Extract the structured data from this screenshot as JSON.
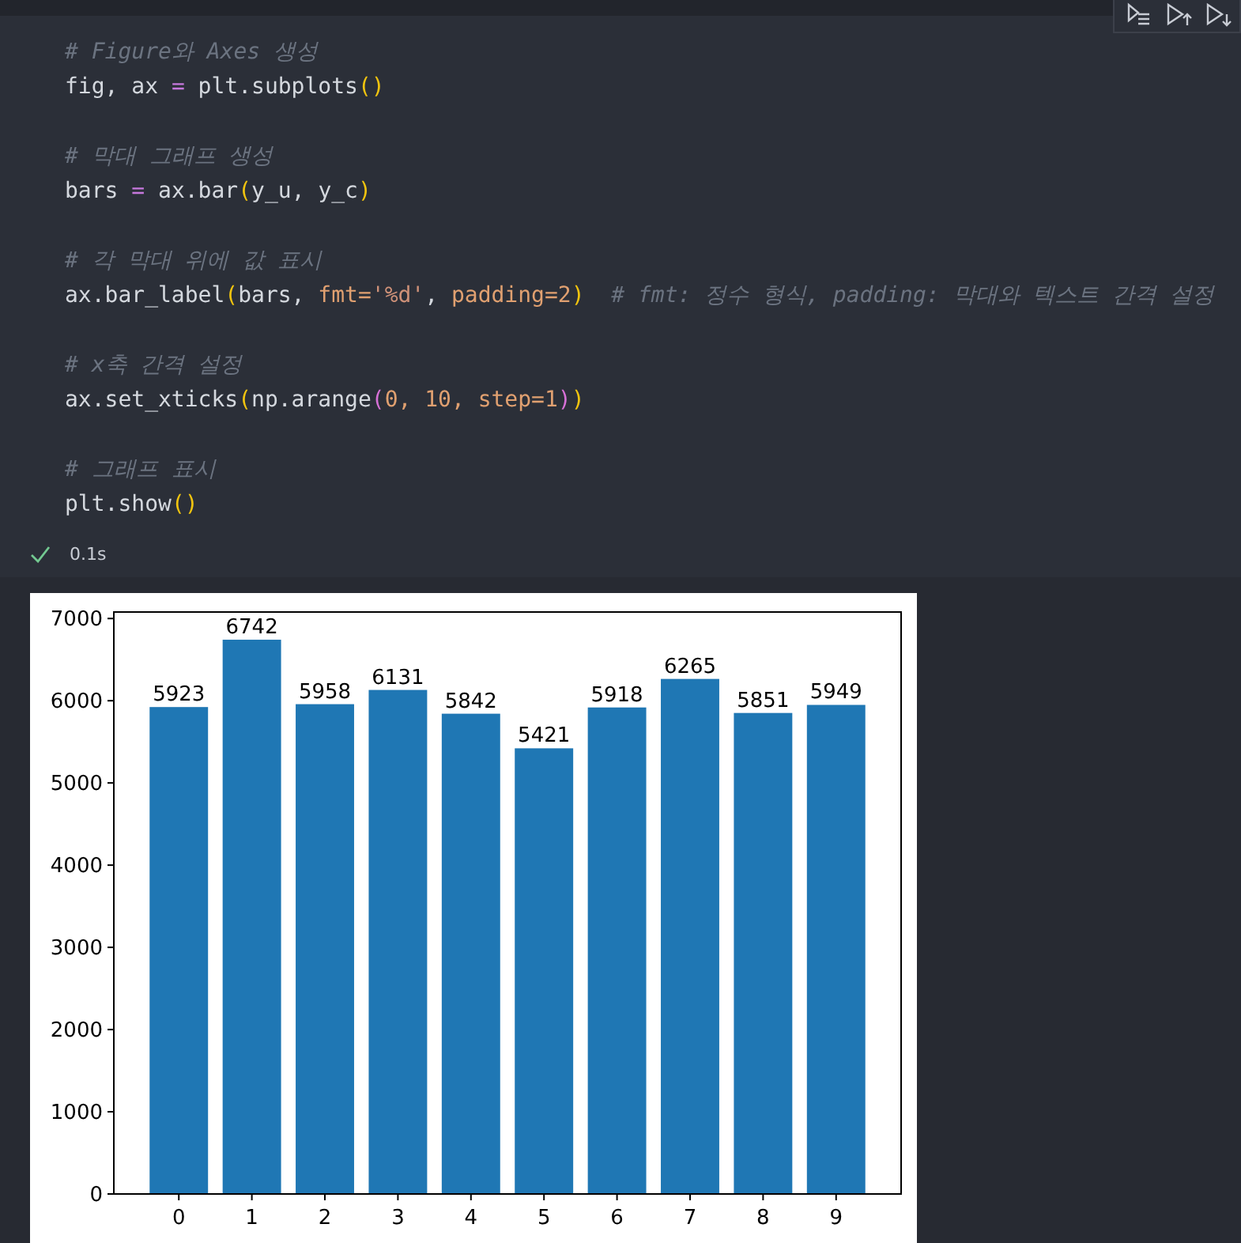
{
  "toolbar": [
    {
      "kind": "run-list"
    },
    {
      "kind": "run-above"
    },
    {
      "kind": "run-below"
    }
  ],
  "code_blocks": [
    {
      "comment": "# Figure와 Axes 생성",
      "code": [
        {
          "text": "fig, ax ",
          "kind": "plain"
        },
        {
          "text": "=",
          "kind": "op"
        },
        {
          "text": " plt.subplots",
          "kind": "plain"
        },
        {
          "text": "()",
          "kind": "paren1"
        }
      ]
    },
    {
      "comment": "# 막대 그래프 생성",
      "code": [
        {
          "text": "bars ",
          "kind": "plain"
        },
        {
          "text": "=",
          "kind": "op"
        },
        {
          "text": " ax.bar",
          "kind": "plain"
        },
        {
          "text": "(",
          "kind": "paren1"
        },
        {
          "text": "y_u, y_c",
          "kind": "plain"
        },
        {
          "text": ")",
          "kind": "paren1"
        }
      ]
    },
    {
      "comment": "# 각 막대 위에 값 표시",
      "code": [
        {
          "text": "ax.bar_label",
          "kind": "plain"
        },
        {
          "text": "(",
          "kind": "paren1"
        },
        {
          "text": "bars, ",
          "kind": "plain"
        },
        {
          "text": "fmt=",
          "kind": "param"
        },
        {
          "text": "'%d'",
          "kind": "string"
        },
        {
          "text": ", ",
          "kind": "plain"
        },
        {
          "text": "padding=2",
          "kind": "param"
        },
        {
          "text": ")",
          "kind": "paren1"
        },
        {
          "text": "  # fmt: 정수 형식, padding: 막대와 텍스트 간격 설정",
          "kind": "comment"
        }
      ]
    },
    {
      "comment": "# x축 간격 설정",
      "code": [
        {
          "text": "ax.set_xticks",
          "kind": "plain"
        },
        {
          "text": "(",
          "kind": "paren1"
        },
        {
          "text": "np.arange",
          "kind": "plain"
        },
        {
          "text": "(",
          "kind": "paren2"
        },
        {
          "text": "0, 10, ",
          "kind": "number"
        },
        {
          "text": "step=1",
          "kind": "param"
        },
        {
          "text": ")",
          "kind": "paren2"
        },
        {
          "text": ")",
          "kind": "paren1"
        }
      ]
    },
    {
      "comment": "# 그래프 표시",
      "code": [
        {
          "text": "plt.show",
          "kind": "plain"
        },
        {
          "text": "()",
          "kind": "paren1"
        }
      ]
    }
  ],
  "status": {
    "succeeded": true,
    "duration": "0.1s"
  },
  "output": {
    "chart_data": {
      "type": "bar",
      "categories": [
        "0",
        "1",
        "2",
        "3",
        "4",
        "5",
        "6",
        "7",
        "8",
        "9"
      ],
      "values": [
        5923,
        6742,
        5958,
        6131,
        5842,
        5421,
        5918,
        6265,
        5851,
        5949
      ],
      "color": "#1f77b4",
      "ylim": [
        0,
        7079
      ],
      "yticks": [
        0,
        1000,
        2000,
        3000,
        4000,
        5000,
        6000,
        7000
      ],
      "data_labels": true
    }
  }
}
